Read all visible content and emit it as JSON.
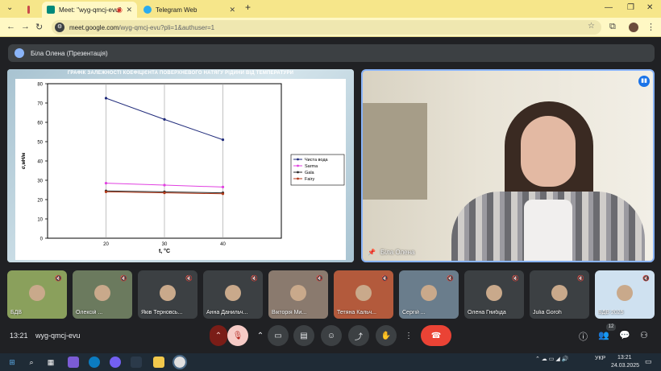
{
  "browser": {
    "tabs": [
      {
        "title": "Meet: \"wyg-qmcj-evu\"",
        "active": true
      },
      {
        "title": "Telegram Web",
        "active": false
      }
    ],
    "url_domain": "meet.google.com",
    "url_path": "/wyg-qmcj-evu?pli=1&authuser=1",
    "theme_color": "#f6e68a"
  },
  "presentation": {
    "label": "Біла Олена (Презентація)",
    "slide_title": "ГРАФІК ЗАЛЕЖНОСТІ КОЕФІЦІЄНТА ПОВЕРХНЕВОГО НАТЯГУ РІДИНИ ВІД ТЕМПЕРАТУРИ"
  },
  "chart_data": {
    "type": "line",
    "title": "ГРАФІК ЗАЛЕЖНОСТІ КОЕФІЦІЄНТА ПОВЕРХНЕВОГО НАТЯГУ РІДИНИ ВІД ТЕМПЕРАТУРИ",
    "xlabel": "t, °C",
    "ylabel": "σ,мН/м",
    "x": [
      20,
      30,
      40
    ],
    "xlim": [
      10,
      50
    ],
    "ylim": [
      0,
      80
    ],
    "yticks": [
      0,
      10,
      20,
      30,
      40,
      50,
      60,
      70,
      80
    ],
    "grid": true,
    "legend_position": "right",
    "series": [
      {
        "name": "Чиста вода",
        "values": [
          72.5,
          61.5,
          51
        ],
        "color": "#1f2a7a"
      },
      {
        "name": "Sarma",
        "values": [
          28.5,
          27.5,
          26.5
        ],
        "color": "#e040e0"
      },
      {
        "name": "Gala",
        "values": [
          24.5,
          24,
          23.5
        ],
        "color": "#2a2a2a"
      },
      {
        "name": "Fairy",
        "values": [
          24,
          23.5,
          23
        ],
        "color": "#b33a1a"
      }
    ]
  },
  "speaker": {
    "name": "Біла Олена"
  },
  "participants": [
    {
      "name": "БДВ",
      "muted": true
    },
    {
      "name": "Олексій ...",
      "muted": true
    },
    {
      "name": "Яків Терновсь...",
      "muted": true
    },
    {
      "name": "Анна Данильч...",
      "muted": true
    },
    {
      "name": "Вікторія Ми...",
      "muted": true
    },
    {
      "name": "Тетяна Кальч...",
      "muted": true
    },
    {
      "name": "Сергій ...",
      "muted": true
    },
    {
      "name": "Олена Гнибіда",
      "muted": true
    },
    {
      "name": "Julia Goroh",
      "muted": true
    },
    {
      "name": "БДВ 2025",
      "muted": true
    }
  ],
  "meeting": {
    "time": "13:21",
    "code": "wyg-qmcj-evu",
    "participant_count": "12"
  },
  "taskbar": {
    "language": "УКР",
    "clock_time": "13:21",
    "clock_date": "24.03.2025"
  }
}
